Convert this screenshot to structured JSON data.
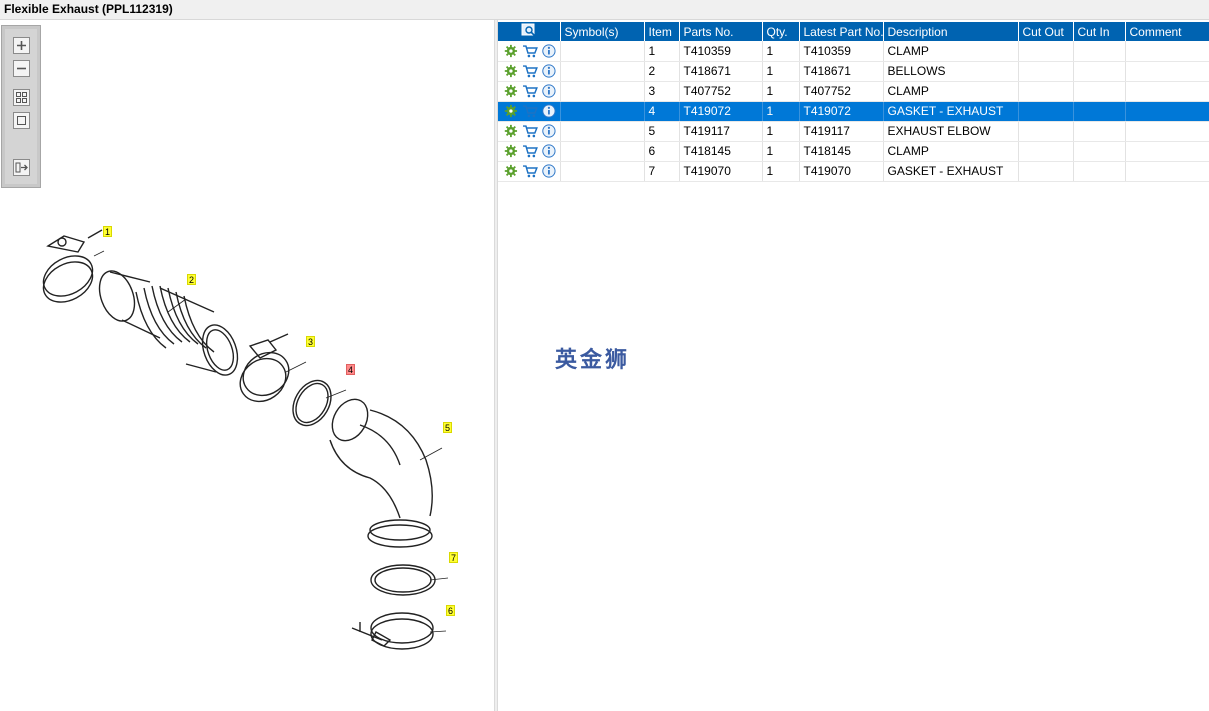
{
  "window": {
    "title": "Flexible Exhaust (PPL112319)"
  },
  "toolbar": {
    "buttons": [
      {
        "name": "zoom-in",
        "icon": "plus-icon"
      },
      {
        "name": "zoom-out",
        "icon": "minus-icon"
      },
      {
        "name": "fit-all",
        "icon": "grid-icon"
      },
      {
        "name": "actual-size",
        "icon": "square-icon"
      },
      {
        "name": "export",
        "icon": "export-arrow-icon"
      }
    ]
  },
  "diagram": {
    "callouts": [
      {
        "label": "1",
        "highlighted": false
      },
      {
        "label": "2",
        "highlighted": false
      },
      {
        "label": "3",
        "highlighted": false
      },
      {
        "label": "4",
        "highlighted": true
      },
      {
        "label": "5",
        "highlighted": false
      },
      {
        "label": "7",
        "highlighted": false
      },
      {
        "label": "6",
        "highlighted": false
      }
    ]
  },
  "watermark": "英金狮",
  "table": {
    "columns": [
      "Symbol(s)",
      "Item",
      "Parts No.",
      "Qty.",
      "Latest Part No.",
      "Description",
      "Cut Out",
      "Cut In",
      "Comment"
    ],
    "rows": [
      {
        "item": "1",
        "part_no": "T410359",
        "qty": "1",
        "latest": "T410359",
        "description": "CLAMP",
        "cut_out": "",
        "cut_in": "",
        "comment": "",
        "selected": false
      },
      {
        "item": "2",
        "part_no": "T418671",
        "qty": "1",
        "latest": "T418671",
        "description": "BELLOWS",
        "cut_out": "",
        "cut_in": "",
        "comment": "",
        "selected": false
      },
      {
        "item": "3",
        "part_no": "T407752",
        "qty": "1",
        "latest": "T407752",
        "description": "CLAMP",
        "cut_out": "",
        "cut_in": "",
        "comment": "",
        "selected": false
      },
      {
        "item": "4",
        "part_no": "T419072",
        "qty": "1",
        "latest": "T419072",
        "description": "GASKET - EXHAUST",
        "cut_out": "",
        "cut_in": "",
        "comment": "",
        "selected": true
      },
      {
        "item": "5",
        "part_no": "T419117",
        "qty": "1",
        "latest": "T419117",
        "description": "EXHAUST ELBOW",
        "cut_out": "",
        "cut_in": "",
        "comment": "",
        "selected": false
      },
      {
        "item": "6",
        "part_no": "T418145",
        "qty": "1",
        "latest": "T418145",
        "description": "CLAMP",
        "cut_out": "",
        "cut_in": "",
        "comment": "",
        "selected": false
      },
      {
        "item": "7",
        "part_no": "T419070",
        "qty": "1",
        "latest": "T419070",
        "description": "GASKET - EXHAUST",
        "cut_out": "",
        "cut_in": "",
        "comment": "",
        "selected": false
      }
    ],
    "row_icons": [
      "gear-icon",
      "cart-icon",
      "info-icon"
    ]
  },
  "colors": {
    "header": "#0063b1",
    "selected_row": "#0078d7",
    "callout": "#ffff33",
    "callout_highlight": "#ff8a8a",
    "watermark": "#3b5aa0"
  }
}
